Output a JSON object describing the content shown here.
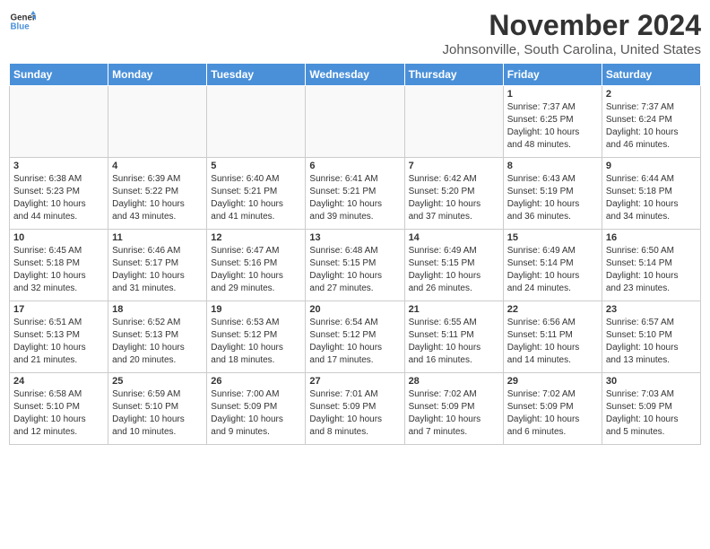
{
  "header": {
    "logo": {
      "line1": "General",
      "line2": "Blue"
    },
    "title": "November 2024",
    "subtitle": "Johnsonville, South Carolina, United States"
  },
  "calendar": {
    "days_of_week": [
      "Sunday",
      "Monday",
      "Tuesday",
      "Wednesday",
      "Thursday",
      "Friday",
      "Saturday"
    ],
    "weeks": [
      [
        {
          "day": "",
          "info": ""
        },
        {
          "day": "",
          "info": ""
        },
        {
          "day": "",
          "info": ""
        },
        {
          "day": "",
          "info": ""
        },
        {
          "day": "",
          "info": ""
        },
        {
          "day": "1",
          "info": "Sunrise: 7:37 AM\nSunset: 6:25 PM\nDaylight: 10 hours\nand 48 minutes."
        },
        {
          "day": "2",
          "info": "Sunrise: 7:37 AM\nSunset: 6:24 PM\nDaylight: 10 hours\nand 46 minutes."
        }
      ],
      [
        {
          "day": "3",
          "info": "Sunrise: 6:38 AM\nSunset: 5:23 PM\nDaylight: 10 hours\nand 44 minutes."
        },
        {
          "day": "4",
          "info": "Sunrise: 6:39 AM\nSunset: 5:22 PM\nDaylight: 10 hours\nand 43 minutes."
        },
        {
          "day": "5",
          "info": "Sunrise: 6:40 AM\nSunset: 5:21 PM\nDaylight: 10 hours\nand 41 minutes."
        },
        {
          "day": "6",
          "info": "Sunrise: 6:41 AM\nSunset: 5:21 PM\nDaylight: 10 hours\nand 39 minutes."
        },
        {
          "day": "7",
          "info": "Sunrise: 6:42 AM\nSunset: 5:20 PM\nDaylight: 10 hours\nand 37 minutes."
        },
        {
          "day": "8",
          "info": "Sunrise: 6:43 AM\nSunset: 5:19 PM\nDaylight: 10 hours\nand 36 minutes."
        },
        {
          "day": "9",
          "info": "Sunrise: 6:44 AM\nSunset: 5:18 PM\nDaylight: 10 hours\nand 34 minutes."
        }
      ],
      [
        {
          "day": "10",
          "info": "Sunrise: 6:45 AM\nSunset: 5:18 PM\nDaylight: 10 hours\nand 32 minutes."
        },
        {
          "day": "11",
          "info": "Sunrise: 6:46 AM\nSunset: 5:17 PM\nDaylight: 10 hours\nand 31 minutes."
        },
        {
          "day": "12",
          "info": "Sunrise: 6:47 AM\nSunset: 5:16 PM\nDaylight: 10 hours\nand 29 minutes."
        },
        {
          "day": "13",
          "info": "Sunrise: 6:48 AM\nSunset: 5:15 PM\nDaylight: 10 hours\nand 27 minutes."
        },
        {
          "day": "14",
          "info": "Sunrise: 6:49 AM\nSunset: 5:15 PM\nDaylight: 10 hours\nand 26 minutes."
        },
        {
          "day": "15",
          "info": "Sunrise: 6:49 AM\nSunset: 5:14 PM\nDaylight: 10 hours\nand 24 minutes."
        },
        {
          "day": "16",
          "info": "Sunrise: 6:50 AM\nSunset: 5:14 PM\nDaylight: 10 hours\nand 23 minutes."
        }
      ],
      [
        {
          "day": "17",
          "info": "Sunrise: 6:51 AM\nSunset: 5:13 PM\nDaylight: 10 hours\nand 21 minutes."
        },
        {
          "day": "18",
          "info": "Sunrise: 6:52 AM\nSunset: 5:13 PM\nDaylight: 10 hours\nand 20 minutes."
        },
        {
          "day": "19",
          "info": "Sunrise: 6:53 AM\nSunset: 5:12 PM\nDaylight: 10 hours\nand 18 minutes."
        },
        {
          "day": "20",
          "info": "Sunrise: 6:54 AM\nSunset: 5:12 PM\nDaylight: 10 hours\nand 17 minutes."
        },
        {
          "day": "21",
          "info": "Sunrise: 6:55 AM\nSunset: 5:11 PM\nDaylight: 10 hours\nand 16 minutes."
        },
        {
          "day": "22",
          "info": "Sunrise: 6:56 AM\nSunset: 5:11 PM\nDaylight: 10 hours\nand 14 minutes."
        },
        {
          "day": "23",
          "info": "Sunrise: 6:57 AM\nSunset: 5:10 PM\nDaylight: 10 hours\nand 13 minutes."
        }
      ],
      [
        {
          "day": "24",
          "info": "Sunrise: 6:58 AM\nSunset: 5:10 PM\nDaylight: 10 hours\nand 12 minutes."
        },
        {
          "day": "25",
          "info": "Sunrise: 6:59 AM\nSunset: 5:10 PM\nDaylight: 10 hours\nand 10 minutes."
        },
        {
          "day": "26",
          "info": "Sunrise: 7:00 AM\nSunset: 5:09 PM\nDaylight: 10 hours\nand 9 minutes."
        },
        {
          "day": "27",
          "info": "Sunrise: 7:01 AM\nSunset: 5:09 PM\nDaylight: 10 hours\nand 8 minutes."
        },
        {
          "day": "28",
          "info": "Sunrise: 7:02 AM\nSunset: 5:09 PM\nDaylight: 10 hours\nand 7 minutes."
        },
        {
          "day": "29",
          "info": "Sunrise: 7:02 AM\nSunset: 5:09 PM\nDaylight: 10 hours\nand 6 minutes."
        },
        {
          "day": "30",
          "info": "Sunrise: 7:03 AM\nSunset: 5:09 PM\nDaylight: 10 hours\nand 5 minutes."
        }
      ]
    ]
  }
}
